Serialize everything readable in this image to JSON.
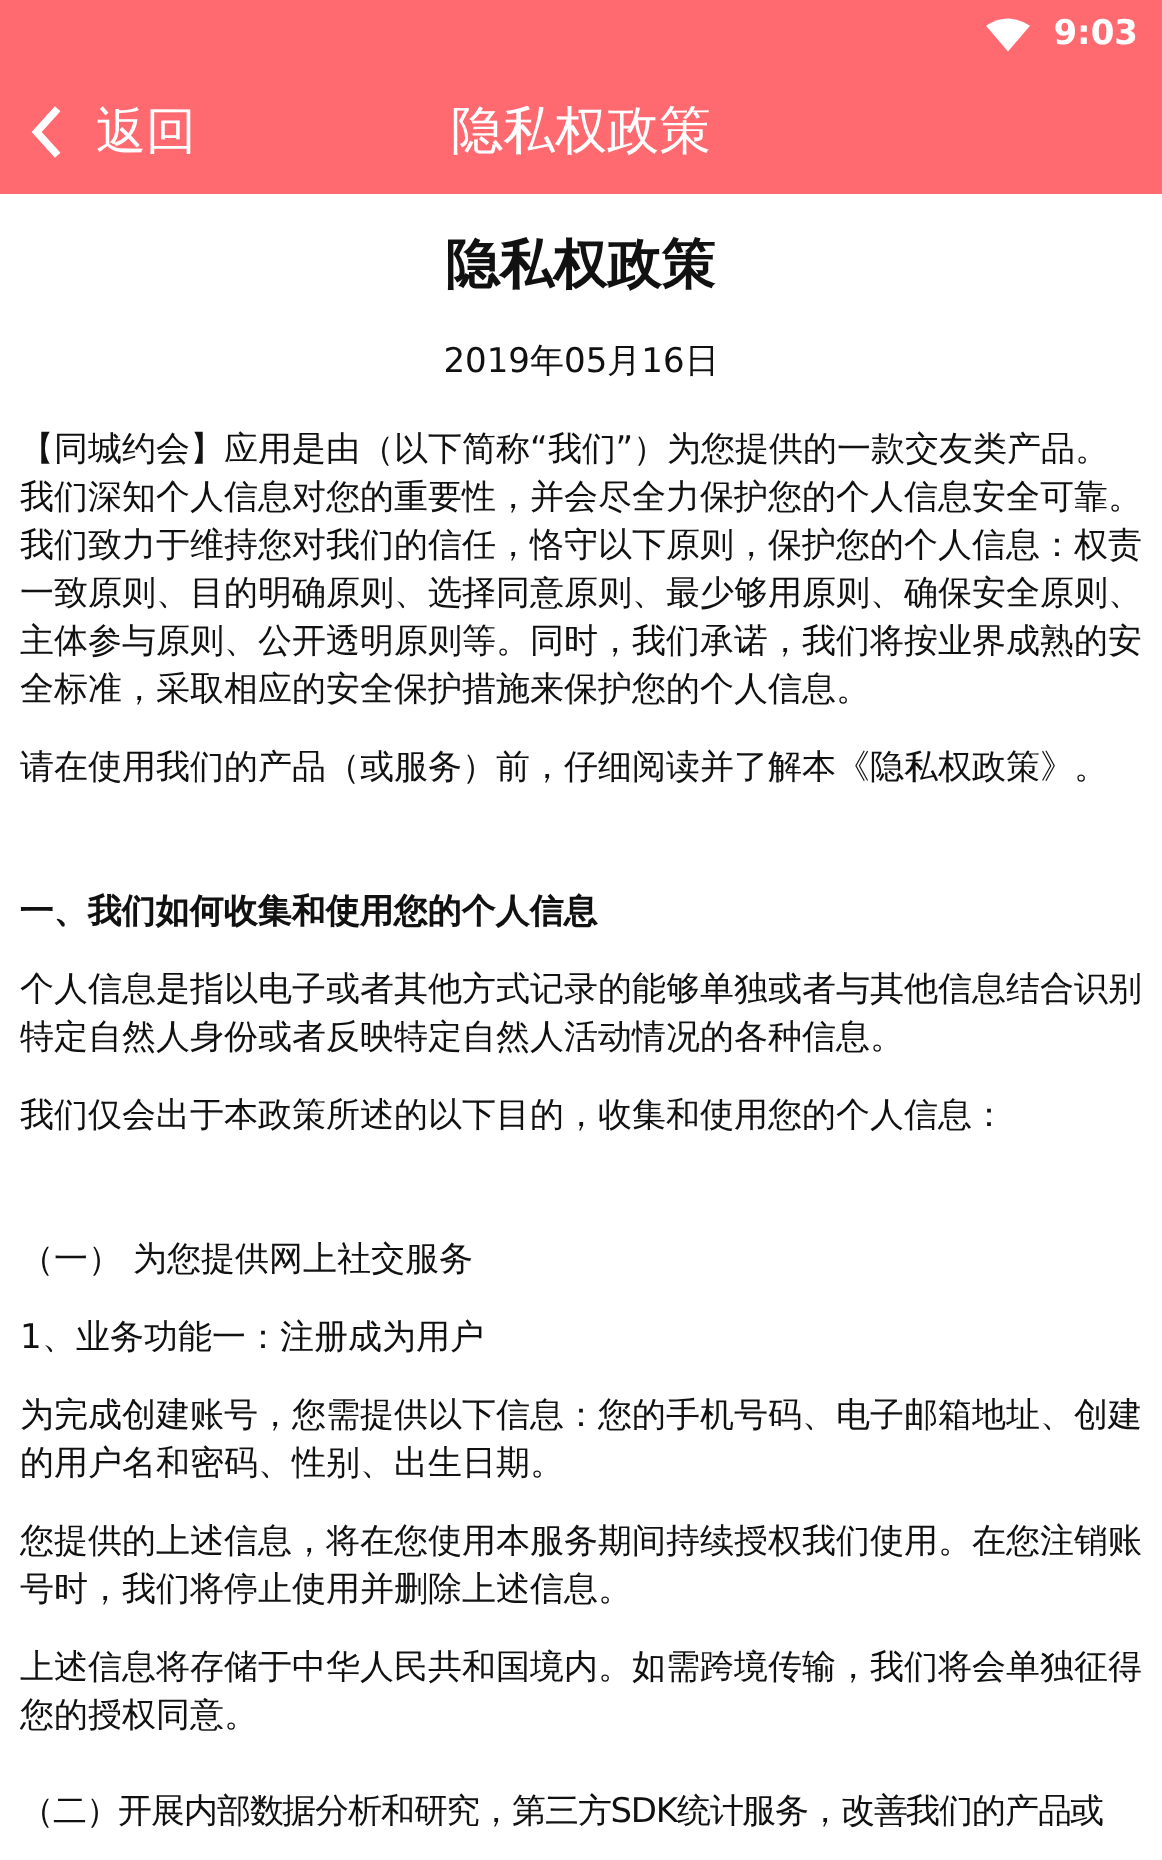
{
  "status_bar": {
    "time": "9:03"
  },
  "nav": {
    "back_label": "返回",
    "title": "隐私权政策"
  },
  "document": {
    "title": "隐私权政策",
    "date": "2019年05月16日",
    "blocks": [
      {
        "kind": "para",
        "text": "【同城约会】应用是由（以下简称“我们”）为您提供的一款交友类产品。我们深知个人信息对您的重要性，并会尽全力保护您的个人信息安全可靠。我们致力于维持您对我们的信任，恪守以下原则，保护您的个人信息：权责一致原则、目的明确原则、选择同意原则、最少够用原则、确保安全原则、主体参与原则、公开透明原则等。同时，我们承诺，我们将按业界成熟的安全标准，采取相应的安全保护措施来保护您的个人信息。"
      },
      {
        "kind": "para",
        "text": "请在使用我们的产品（或服务）前，仔细阅读并了解本《隐私权政策》。"
      },
      {
        "kind": "heading",
        "text": "一、我们如何收集和使用您的个人信息"
      },
      {
        "kind": "para",
        "text": "个人信息是指以电子或者其他方式记录的能够单独或者与其他信息结合识别特定自然人身份或者反映特定自然人活动情况的各种信息。"
      },
      {
        "kind": "para",
        "text": "我们仅会出于本政策所述的以下目的，收集和使用您的个人信息："
      },
      {
        "kind": "section",
        "text": "（一） 为您提供网上社交服务"
      },
      {
        "kind": "para",
        "text": "1、业务功能一：注册成为用户"
      },
      {
        "kind": "para",
        "text": "为完成创建账号，您需提供以下信息：您的手机号码、电子邮箱地址、创建的用户名和密码、性别、出生日期。"
      },
      {
        "kind": "para",
        "text": "您提供的上述信息，将在您使用本服务期间持续授权我们使用。在您注销账号时，我们将停止使用并删除上述信息。"
      },
      {
        "kind": "para",
        "text": "上述信息将存储于中华人民共和国境内。如需跨境传输，我们将会单独征得您的授权同意。"
      },
      {
        "kind": "section",
        "text": "（二）开展内部数据分析和研究，第三方SDK统计服务，改善我们的产品或"
      }
    ]
  }
}
